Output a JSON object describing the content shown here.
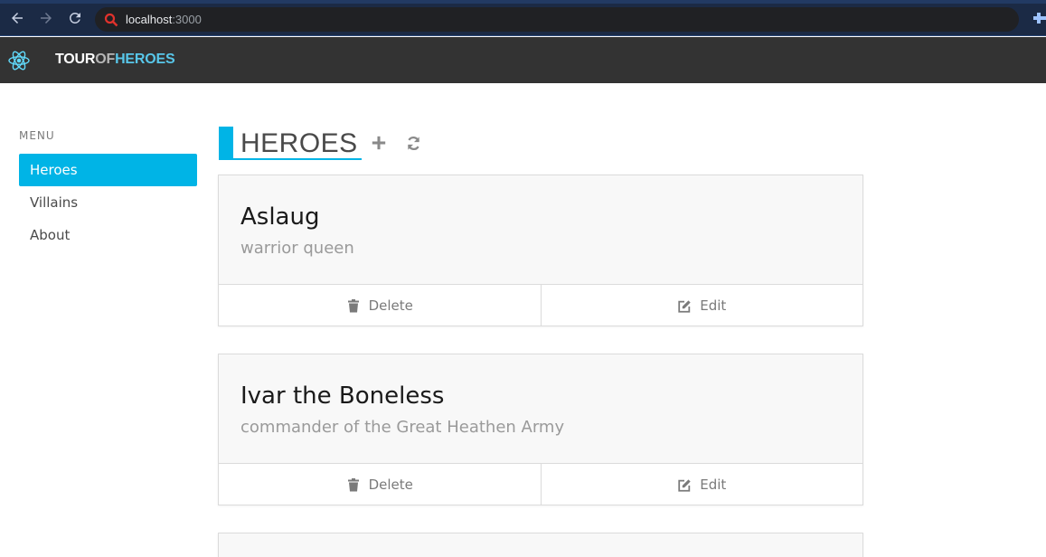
{
  "browser": {
    "url_host": "localhost",
    "url_port": ":3000"
  },
  "header": {
    "brand_part1": "TOUR",
    "brand_part2": "OF",
    "brand_part3": "HEROES"
  },
  "sidebar": {
    "menu_label": "MENU",
    "items": [
      {
        "label": "Heroes",
        "active": true
      },
      {
        "label": "Villains",
        "active": false
      },
      {
        "label": "About",
        "active": false
      }
    ]
  },
  "main": {
    "title": "HEROES",
    "heroes": [
      {
        "name": "Aslaug",
        "description": "warrior queen",
        "delete_label": "Delete",
        "edit_label": "Edit"
      },
      {
        "name": "Ivar the Boneless",
        "description": "commander of the Great Heathen Army",
        "delete_label": "Delete",
        "edit_label": "Edit"
      }
    ]
  },
  "colors": {
    "accent": "#00b4e6",
    "header_bg": "#333333",
    "brand_heroes": "#58c7ea"
  },
  "icons": [
    "back-icon",
    "forward-icon",
    "reload-icon",
    "search-icon",
    "react-logo-icon",
    "add-icon",
    "refresh-icon",
    "trash-icon",
    "edit-icon"
  ]
}
